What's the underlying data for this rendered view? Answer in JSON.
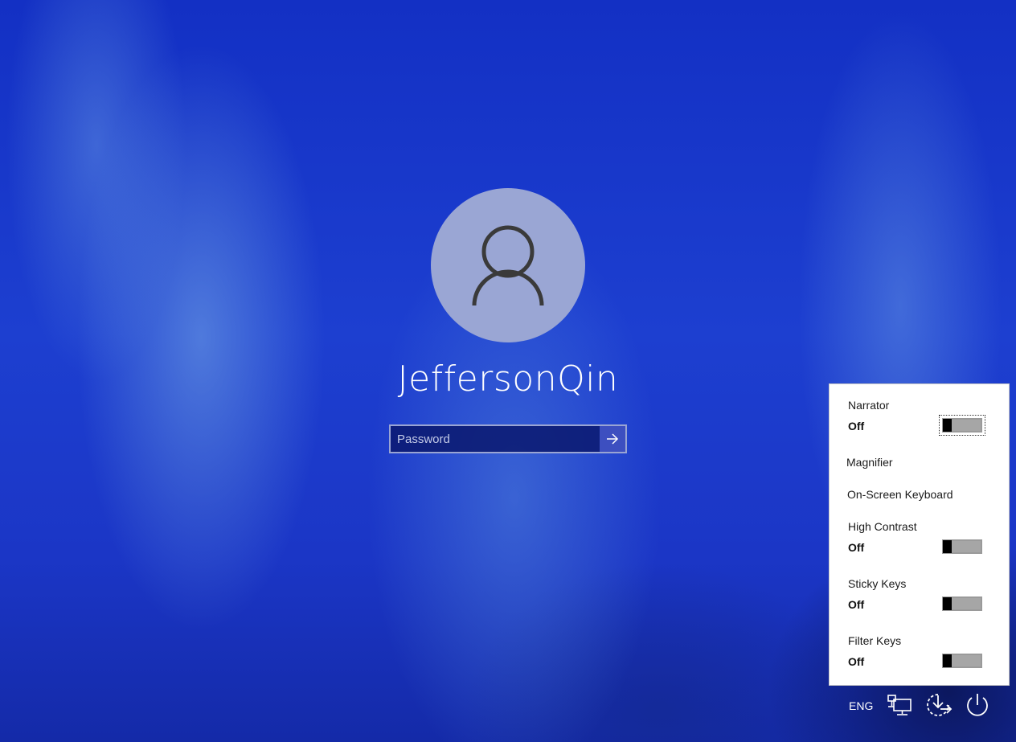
{
  "login": {
    "username": "JeffersonQin",
    "password_placeholder": "Password"
  },
  "ease_of_access": {
    "items": [
      {
        "label": "Narrator",
        "state": "Off"
      },
      {
        "label": "Magnifier"
      },
      {
        "label": "On-Screen Keyboard"
      },
      {
        "label": "High Contrast",
        "state": "Off"
      },
      {
        "label": "Sticky Keys",
        "state": "Off"
      },
      {
        "label": "Filter Keys",
        "state": "Off"
      }
    ]
  },
  "tray": {
    "language": "ENG",
    "icons": [
      "network-icon",
      "ease-of-access-icon",
      "power-icon"
    ]
  },
  "colors": {
    "background_accent": "#1a34c8",
    "avatar_bg": "#9aa6d4",
    "submit_button": "#3d4fc0"
  }
}
